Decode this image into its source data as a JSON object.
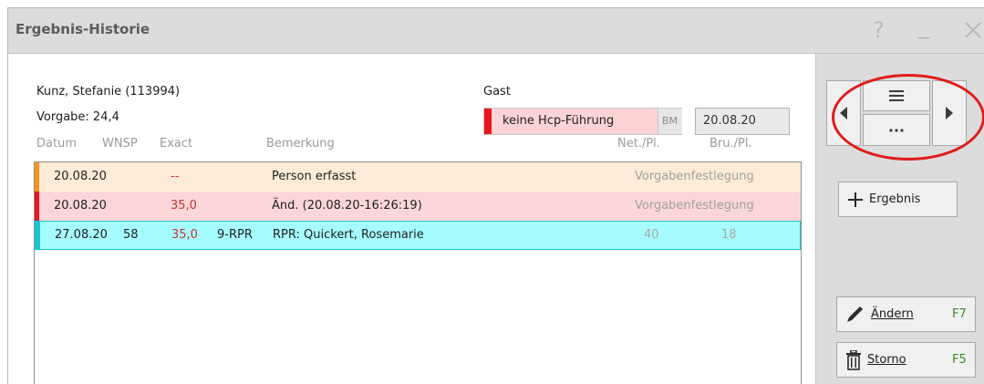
{
  "window": {
    "title": "Ergebnis-Historie",
    "controls": {
      "help": "?",
      "minimize": "_",
      "close": "X"
    }
  },
  "player": {
    "name": "Kunz, Stefanie (113994)",
    "handicap": "Vorgabe: 24,4"
  },
  "gast": {
    "label": "Gast",
    "hcp_status": "keine Hcp-Führung",
    "hcp_suffix": "BM",
    "date": "20.08.20"
  },
  "columns": {
    "datum": "Datum",
    "wnsp": "WNSP",
    "exact": "Exact",
    "bemerkung": "Bemerkung",
    "net": "Net./Pl.",
    "bru": "Bru./Pl."
  },
  "rows": [
    {
      "date": "20.08.20",
      "wnsp": "",
      "exact": "--",
      "code": "",
      "remark": "Person erfasst",
      "net": "",
      "bru": "",
      "note": "Vorgabenfestlegung",
      "stripe_color": "#f7941d"
    },
    {
      "date": "20.08.20",
      "wnsp": "",
      "exact": "35,0",
      "code": "",
      "remark": "Änd. (20.08.20-16:26:19)",
      "net": "",
      "bru": "",
      "note": "Vorgabenfestlegung",
      "stripe_color": "#e8161c"
    },
    {
      "date": "27.08.20",
      "wnsp": "58",
      "exact": "35,0",
      "code": "9-RPR",
      "remark": "RPR: Quickert, Rosemarie",
      "net": "40",
      "bru": "18",
      "note": "",
      "stripe_color": "#18c6cf"
    }
  ],
  "nav": {
    "prev_icon": "triangle-left-icon",
    "menu_icon": "hamburger-icon",
    "more_icon": "more-dots-icon",
    "next_icon": "triangle-right-icon",
    "highlight_color": "#e01b1b"
  },
  "actions": {
    "add_result": {
      "label": "Ergebnis",
      "icon": "plus-icon"
    },
    "edit": {
      "label": "Ändern",
      "key": "F7",
      "icon": "pencil-icon"
    },
    "cancel": {
      "label": "Storno",
      "key": "F5",
      "icon": "trash-icon"
    }
  },
  "colors": {
    "titlebar": "#dcdcdc",
    "hcp_box": "#fbd3d5",
    "row_1": "#feebd7",
    "row_2": "#fbd6d8",
    "row_3": "#a6fbff",
    "shortcut_key": "#3a8a1e"
  }
}
